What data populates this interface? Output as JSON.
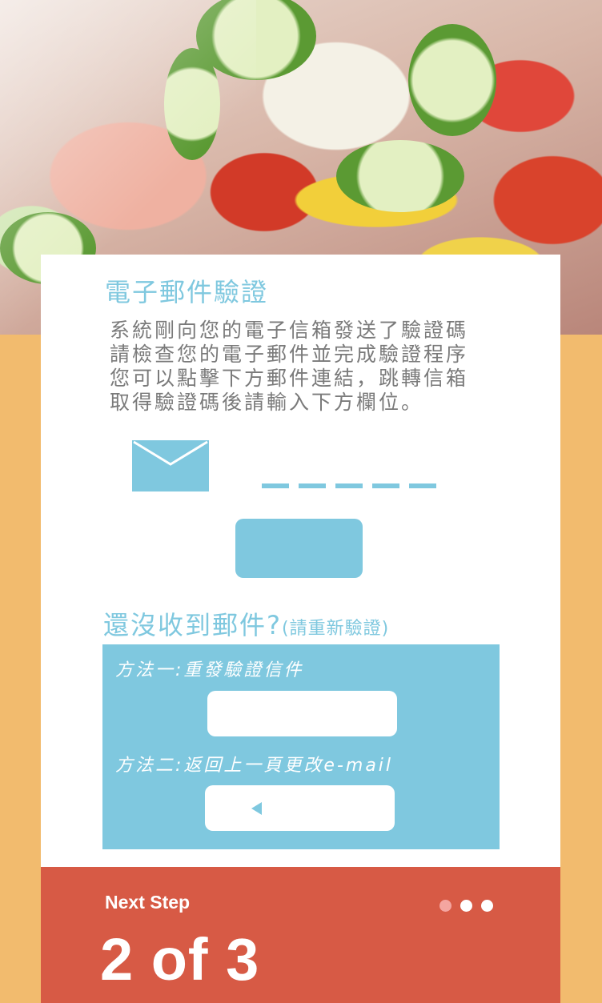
{
  "verification": {
    "title": "電子郵件驗證",
    "description": [
      "系統剛向您的電子信箱發送了驗證碼",
      "請檢查您的電子郵件並完成驗證程序",
      "您可以點擊下方郵件連結，跳轉信箱",
      "取得驗證碼後請輸入下方欄位。"
    ],
    "code_length": 5
  },
  "resend": {
    "heading": "還沒收到郵件?",
    "heading_note": "(請重新驗證)",
    "method1_label": "方法一:重發驗證信件",
    "method2_label": "方法二:返回上一頁更改e-mail"
  },
  "footer": {
    "next_label": "Next Step",
    "step_counter": "2 of 3",
    "current_step": 2,
    "total_steps": 3
  },
  "colors": {
    "accent": "#7fc8df",
    "footer": "#d75a45",
    "background": "#f2bb6e"
  },
  "icons": {
    "mail": "envelope-icon",
    "back": "left-arrow-icon"
  }
}
